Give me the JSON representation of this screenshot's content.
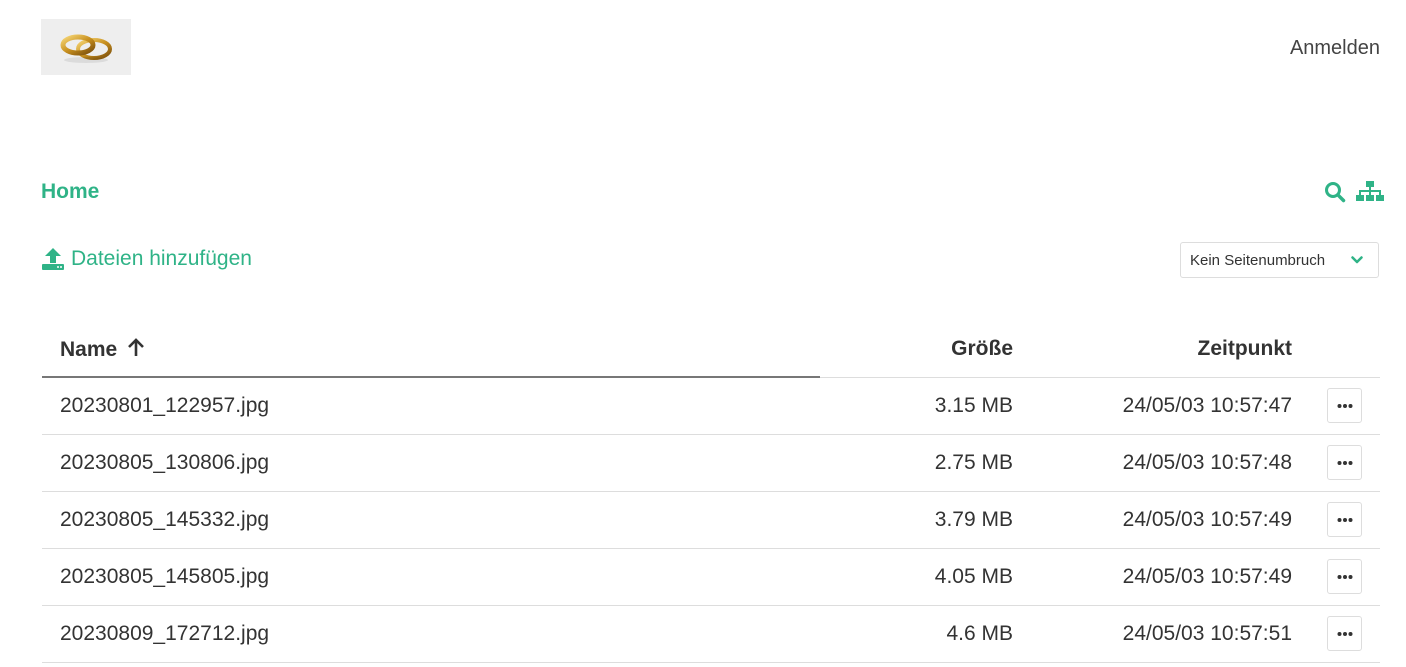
{
  "header": {
    "logo_icon": "wedding-rings-icon",
    "login_label": "Anmelden"
  },
  "breadcrumb": {
    "home_label": "Home"
  },
  "toolbar": {
    "search_icon": "search-icon",
    "sitemap_icon": "sitemap-icon"
  },
  "upload": {
    "label": "Dateien hinzufügen",
    "icon": "upload-icon"
  },
  "pagebreak": {
    "selected": "Kein Seitenumbruch"
  },
  "table": {
    "columns": {
      "name": "Name",
      "size": "Größe",
      "time": "Zeitpunkt"
    },
    "sort": {
      "column": "name",
      "direction": "ascending"
    },
    "rows": [
      {
        "name": "20230801_122957.jpg",
        "size": "3.15 MB",
        "time": "24/05/03 10:57:47"
      },
      {
        "name": "20230805_130806.jpg",
        "size": "2.75 MB",
        "time": "24/05/03 10:57:48"
      },
      {
        "name": "20230805_145332.jpg",
        "size": "3.79 MB",
        "time": "24/05/03 10:57:49"
      },
      {
        "name": "20230805_145805.jpg",
        "size": "4.05 MB",
        "time": "24/05/03 10:57:49"
      },
      {
        "name": "20230809_172712.jpg",
        "size": "4.6 MB",
        "time": "24/05/03 10:57:51"
      }
    ]
  },
  "colors": {
    "accent": "#2fb387",
    "text": "#333333",
    "border": "#dddddd"
  }
}
